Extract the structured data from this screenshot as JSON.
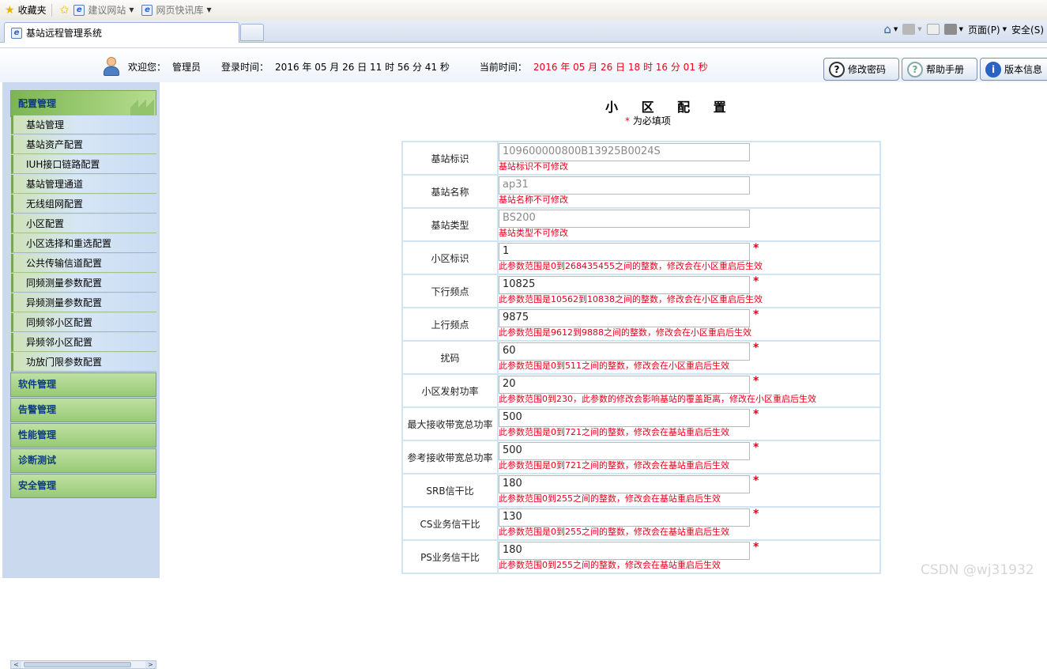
{
  "favbar": {
    "favorites": "收藏夹",
    "suggested": "建议网站",
    "slices": "网页快讯库"
  },
  "tab": {
    "title": "基站远程管理系统"
  },
  "command_bar": {
    "page": "页面(P)",
    "safety": "安全(S)"
  },
  "header": {
    "welcome_label": "欢迎您：",
    "user": "管理员",
    "login_label": "登录时间：",
    "login_time": "2016 年 05 月 26 日 11 时 56 分 41 秒",
    "current_label": "当前时间：",
    "current_time": "2016 年 05 月 26 日 18 时 16 分 01 秒",
    "buttons": {
      "change_password": "修改密码",
      "help": "帮助手册",
      "version": "版本信息"
    }
  },
  "sidebar": {
    "active_group": "配置管理",
    "items": [
      "基站管理",
      "基站资产配置",
      "IUH接口链路配置",
      "基站管理通道",
      "无线组网配置",
      "小区配置",
      "小区选择和重选配置",
      "公共传输信道配置",
      "同频测量参数配置",
      "异频测量参数配置",
      "同频邻小区配置",
      "异频邻小区配置",
      "功放门限参数配置"
    ],
    "groups": [
      "软件管理",
      "告警管理",
      "性能管理",
      "诊断测试",
      "安全管理"
    ]
  },
  "form": {
    "title": "小 区 配 置",
    "required_note": "为必填项",
    "required_star": "*",
    "rows": [
      {
        "label": "基站标识",
        "value": "109600000800B13925B0024S",
        "readonly": true,
        "hint": "基站标识不可修改"
      },
      {
        "label": "基站名称",
        "value": "ap31",
        "readonly": true,
        "hint": "基站名称不可修改"
      },
      {
        "label": "基站类型",
        "value": "BS200",
        "readonly": true,
        "hint": "基站类型不可修改"
      },
      {
        "label": "小区标识",
        "value": "1",
        "readonly": false,
        "hint": "此参数范围是0到268435455之间的整数，修改会在小区重启后生效"
      },
      {
        "label": "下行频点",
        "value": "10825",
        "readonly": false,
        "hint": "此参数范围是10562到10838之间的整数，修改会在小区重启后生效"
      },
      {
        "label": "上行频点",
        "value": "9875",
        "readonly": false,
        "hint": "此参数范围是9612到9888之间的整数，修改会在小区重启后生效"
      },
      {
        "label": "扰码",
        "value": "60",
        "readonly": false,
        "hint": "此参数范围是0到511之间的整数，修改会在小区重启后生效"
      },
      {
        "label": "小区发射功率",
        "value": "20",
        "readonly": false,
        "hint": "此参数范围0到230，此参数的修改会影响基站的覆盖距离，修改在小区重启后生效"
      },
      {
        "label": "最大接收带宽总功率",
        "value": "500",
        "readonly": false,
        "hint": "此参数范围是0到721之间的整数，修改会在基站重启后生效"
      },
      {
        "label": "参考接收带宽总功率",
        "value": "500",
        "readonly": false,
        "hint": "此参数范围是0到721之间的整数，修改会在基站重启后生效"
      },
      {
        "label": "SRB信干比",
        "value": "180",
        "readonly": false,
        "hint": "此参数范围0到255之间的整数，修改会在基站重启后生效"
      },
      {
        "label": "CS业务信干比",
        "value": "130",
        "readonly": false,
        "hint": "此参数范围是0到255之间的整数，修改会在基站重启后生效"
      },
      {
        "label": "PS业务信干比",
        "value": "180",
        "readonly": false,
        "hint": "此参数范围0到255之间的整数，修改会在基站重启后生效"
      }
    ]
  },
  "watermark": "CSDN @wj31932"
}
